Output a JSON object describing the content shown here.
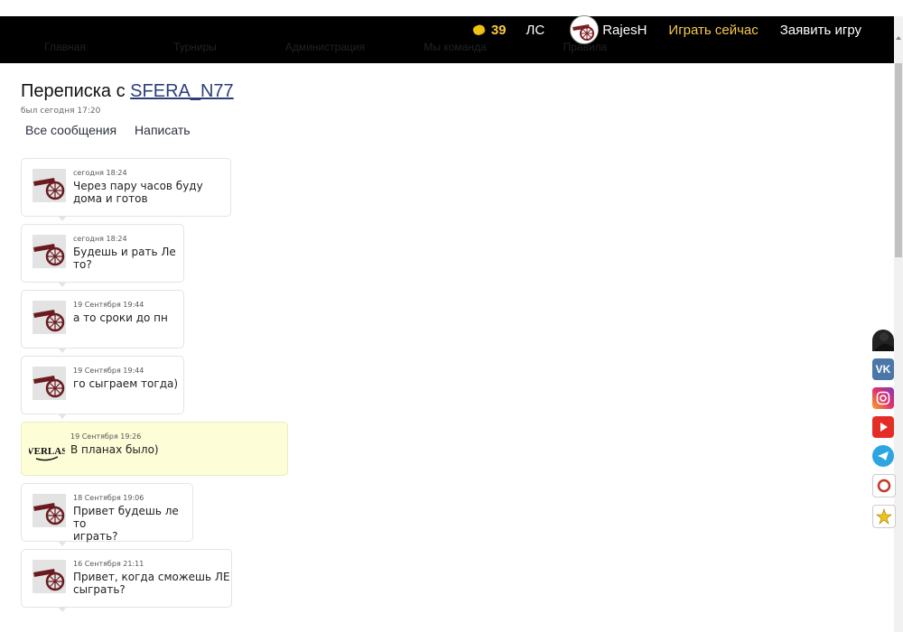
{
  "topbar": {
    "nav_items": [
      "Главная",
      "Турниры",
      "Администрация",
      "Мы команда",
      "Правила"
    ],
    "coins": "39",
    "ls_label": "ЛС",
    "username": "RajesH",
    "play_now": "Играть сейчас",
    "declare_game": "Заявить игру"
  },
  "header": {
    "title_prefix": "Переписка с ",
    "partner": "SFERA_N77",
    "last_seen": "был сегодня 17:20",
    "tab_all": "Все сообщения",
    "tab_write": "Написать"
  },
  "messages": [
    {
      "time": "сегодня 18:24",
      "line1": "Через пару часов буду",
      "line2": "дома и готов",
      "mine": false
    },
    {
      "time": "сегодня 18:24",
      "line1": "Будешь и рать Ле",
      "line2": "то?",
      "mine": false
    },
    {
      "time": "19 Сентября 19:44",
      "line1": "а то сроки до пн",
      "line2": "",
      "mine": false
    },
    {
      "time": "19 Сентября 19:44",
      "line1": "го сыграем тогда)",
      "line2": "",
      "mine": false
    },
    {
      "time": "19 Сентября 19:26",
      "line1": "В планах было)",
      "line2": "",
      "mine": true
    },
    {
      "time": "18 Сентября 19:06",
      "line1": "Привет будешь ле то",
      "line2": "играть?",
      "mine": false
    },
    {
      "time": "16 Сентября 21:11",
      "line1": "Привет, когда сможешь ЛЕ",
      "line2": "сыграть?",
      "mine": false
    }
  ],
  "my_avatar_text": "VERLAS",
  "social": [
    "vk-icon",
    "instagram-icon",
    "youtube-icon",
    "telegram-icon",
    "ring-icon",
    "star-icon"
  ],
  "colors": {
    "accent": "#f7c948",
    "mine_bg": "#fdfdd8",
    "link": "#2c3e7a"
  }
}
